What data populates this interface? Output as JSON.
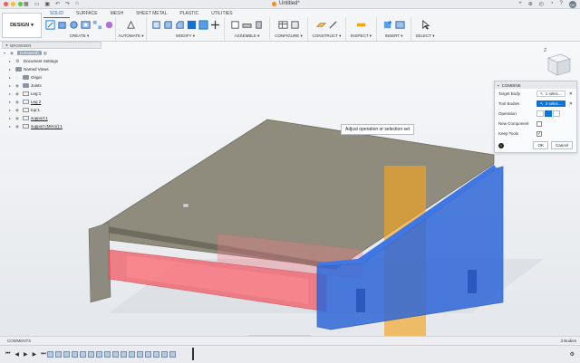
{
  "window": {
    "title": "Untitled*",
    "user_initials": "DK"
  },
  "ribbon": {
    "design_label": "DESIGN",
    "tabs": [
      "SOLID",
      "SURFACE",
      "MESH",
      "SHEET METAL",
      "PLASTIC",
      "UTILITIES"
    ],
    "active_tab": "SOLID",
    "groups": [
      {
        "label": "CREATE ▾",
        "icons": 6
      },
      {
        "label": "AUTOMATE ▾",
        "icons": 1
      },
      {
        "label": "MODIFY ▾",
        "icons": 6
      },
      {
        "label": "ASSEMBLE ▾",
        "icons": 3
      },
      {
        "label": "CONFIGURE ▾",
        "icons": 2
      },
      {
        "label": "CONSTRUCT ▾",
        "icons": 2
      },
      {
        "label": "INSPECT ▾",
        "icons": 1
      },
      {
        "label": "INSERT ▾",
        "icons": 2
      },
      {
        "label": "SELECT ▾",
        "icons": 1
      }
    ]
  },
  "browser": {
    "header": "BROWSER",
    "root": "(Unsaved)",
    "items": [
      {
        "label": "Document Settings",
        "kind": "gear"
      },
      {
        "label": "Named Views",
        "kind": "folder"
      },
      {
        "label": "Origin",
        "kind": "folder"
      },
      {
        "label": "Joints",
        "kind": "folder"
      },
      {
        "label": "Leg:1",
        "kind": "component"
      },
      {
        "label": "Leg 2",
        "kind": "component"
      },
      {
        "label": "top:1",
        "kind": "component"
      },
      {
        "label": "support:1",
        "kind": "component"
      },
      {
        "label": "support (Mirror):1",
        "kind": "component"
      }
    ]
  },
  "combine": {
    "title": "COMBINE",
    "target_body_label": "Target Body",
    "target_body_value": "1 selec...",
    "tool_bodies_label": "Tool Bodies",
    "tool_bodies_value": "2 selec...",
    "operation_label": "Operation",
    "new_component_label": "New Component",
    "keep_tools_label": "Keep Tools",
    "ok_label": "OK",
    "cancel_label": "Cancel"
  },
  "tooltip": "Adjust operation or selection set",
  "comments_label": "COMMENTS",
  "bodies_count": "3 Bodies",
  "colors": {
    "accent": "#0a75d6",
    "plate": "#8f8c7d",
    "red_body": "#f05a64",
    "blue_body": "#2f67d8",
    "orange_plane": "#f2a51f"
  }
}
